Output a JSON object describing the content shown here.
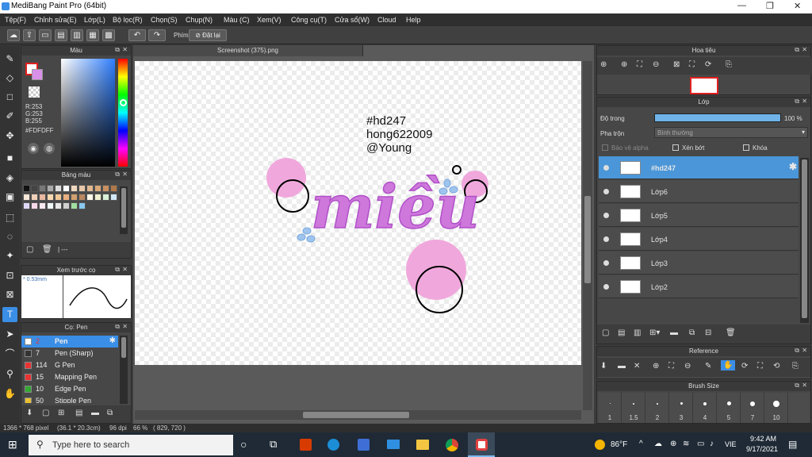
{
  "window": {
    "title": "MediBang Paint Pro (64bit)",
    "minimize": "—",
    "maximize": "❐",
    "close": "✕"
  },
  "menu": [
    "Tệp(F)",
    "Chỉnh sửa(E)",
    "Lớp(L)",
    "Bộ lọc(R)",
    "Chọn(S)",
    "Chụp(N)",
    "Màu (C)",
    "Xem(V)",
    "Công cụ(T)",
    "Cửa sổ(W)",
    "Cloud",
    "Help"
  ],
  "toolbar": {
    "shortcut_label": "Phím",
    "reset_label": "Đặt lại"
  },
  "color_panel": {
    "title": "Màu",
    "r": "R:253",
    "g": "G:253",
    "b": "B:255",
    "hex": "#FDFDFF"
  },
  "palette_panel": {
    "title": "Bảng màu",
    "footer": "| ---"
  },
  "preview_panel": {
    "title": "Xem trước cọ",
    "size": "0.53mm"
  },
  "brush_panel": {
    "title": "Cọ: Pen",
    "items": [
      {
        "size": "2",
        "name": "Pen",
        "color": "#ffffff"
      },
      {
        "size": "7",
        "name": "Pen (Sharp)",
        "color": "#333333"
      },
      {
        "size": "114",
        "name": "G Pen",
        "color": "#e83333"
      },
      {
        "size": "15",
        "name": "Mapping Pen",
        "color": "#e83333"
      },
      {
        "size": "10",
        "name": "Edge Pen",
        "color": "#e83333"
      },
      {
        "size": "50",
        "name": "Stipple Pen",
        "color": "#e8c033"
      }
    ]
  },
  "canvas": {
    "tab_title": "Screenshot (375).png",
    "text_lines": [
      "#hd247",
      "hong622009",
      "@Young"
    ],
    "art_word": "miều"
  },
  "navigator_panel": {
    "title": "Hoa tiêu"
  },
  "layer_panel": {
    "title": "Lớp",
    "opacity_label": "Độ trong",
    "opacity_value": "100 %",
    "opacity": 1.0,
    "blend_label": "Pha trộn",
    "blend_value": "Bình thường",
    "protect_alpha": "Bảo vệ alpha",
    "clipping": "Xén bớt",
    "lock": "Khóa",
    "layers": [
      {
        "name": "#hd247",
        "selected": true
      },
      {
        "name": "Lớp6",
        "selected": false
      },
      {
        "name": "Lớp5",
        "selected": false
      },
      {
        "name": "Lớp4",
        "selected": false
      },
      {
        "name": "Lớp3",
        "selected": false
      },
      {
        "name": "Lớp2",
        "selected": false
      }
    ]
  },
  "reference_panel": {
    "title": "Reference"
  },
  "brushsize_panel": {
    "title": "Brush Size",
    "sizes": [
      "1",
      "1.5",
      "2",
      "3",
      "4",
      "5",
      "7",
      "10"
    ]
  },
  "status": {
    "dims": "1366 * 768 pixel",
    "cm": "(36.1 * 20.3cm)",
    "dpi": "96 dpi",
    "zoom": "66 %",
    "coords": "( 829, 720 )"
  },
  "taskbar": {
    "search_placeholder": "Type here to search",
    "weather": "86°F",
    "lang": "VIE",
    "time": "9:42 AM",
    "date": "9/17/2021"
  }
}
